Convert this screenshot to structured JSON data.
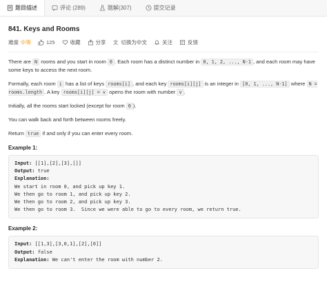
{
  "tabs": [
    {
      "label": "题目描述",
      "icon": "document-icon",
      "active": true
    },
    {
      "label": "评论 (289)",
      "icon": "comment-icon",
      "active": false
    },
    {
      "label": "题解(307)",
      "icon": "flask-icon",
      "active": false
    },
    {
      "label": "提交记录",
      "icon": "clock-icon",
      "active": false
    }
  ],
  "problem": {
    "title": "841. Keys and Rooms",
    "difficulty_label": "难度",
    "difficulty": "中等",
    "likes": "125",
    "favorite": "收藏",
    "share": "分享",
    "switch_lang": "切换为中文",
    "follow": "关注",
    "feedback": "反馈"
  },
  "accent": {
    "difficulty": "#ffa116"
  },
  "desc": {
    "p1a": "There are ",
    "p1_n": "N",
    "p1b": " rooms and you start in room ",
    "p1_zero": "0",
    "p1c": ". Each room has a distinct number in ",
    "p1_range": "0, 1, 2, ..., N-1",
    "p1d": ", and each room may have some keys to access the next room.",
    "p2a": "Formally, each room ",
    "p2_i": "i",
    "p2b": " has a list of keys ",
    "p2_roomsi": "rooms[i]",
    "p2c": ", and each key ",
    "p2_roomsij": "rooms[i][j]",
    "p2d": " is an integer in ",
    "p2_range": "[0, 1, ..., N-1]",
    "p2e": " where ",
    "p2_nlen": "N = rooms.length",
    "p2f": ". A key ",
    "p2_keyv": "rooms[i][j] = v",
    "p2g": " opens the room with number ",
    "p2_v": "v",
    "p2h": ".",
    "p3a": "Initially, all the rooms start locked (except for room ",
    "p3_zero": "0",
    "p3b": ").",
    "p4": "You can walk back and forth between rooms freely.",
    "p5a": "Return ",
    "p5_true": "true",
    "p5b": " if and only if you can enter every room."
  },
  "examples": [
    {
      "title": "Example 1:",
      "input_label": "Input:",
      "input": " [[1],[2],[3],[]]",
      "output_label": "Output:",
      "output": " true",
      "explanation_label": "Explanation:",
      "lines": [
        "We start in room 0, and pick up key 1.",
        "We then go to room 1, and pick up key 2.",
        "We then go to room 2, and pick up key 3.",
        "We then go to room 3.  Since we were able to go to every room, we return true."
      ]
    },
    {
      "title": "Example 2:",
      "input_label": "Input:",
      "input": " [[1,3],[3,0,1],[2],[0]]",
      "output_label": "Output:",
      "output": " false",
      "explanation_label": "Explanation:",
      "explanation": " We can't enter the room with number 2."
    }
  ]
}
